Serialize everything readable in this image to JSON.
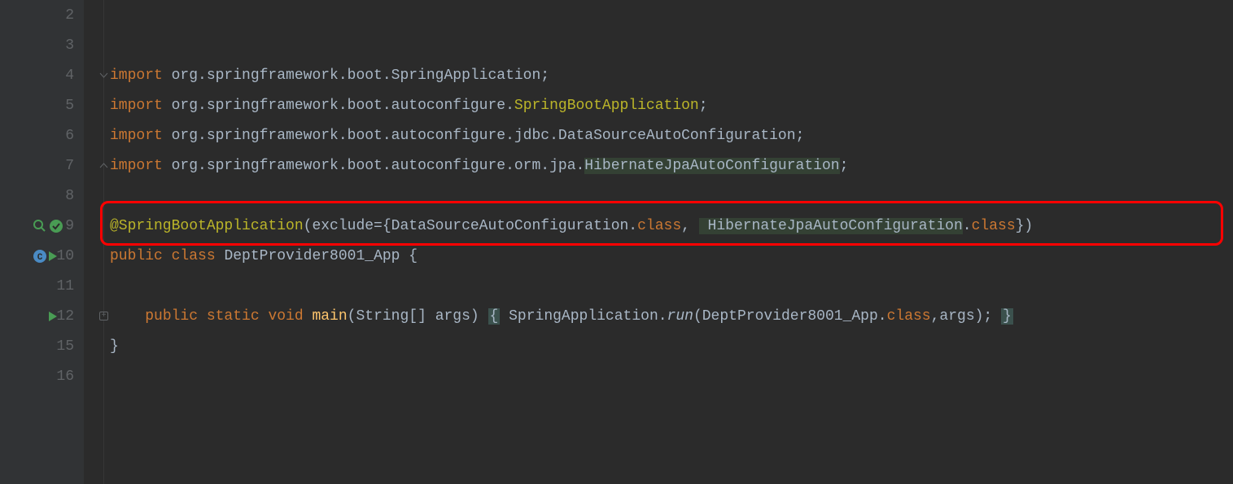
{
  "gutter": {
    "lines": [
      "2",
      "3",
      "4",
      "5",
      "6",
      "7",
      "8",
      "9",
      "10",
      "11",
      "12",
      "15",
      "16"
    ]
  },
  "code": {
    "l4": {
      "kw": "import",
      "rest": " org.springframework.boot.SpringApplication;"
    },
    "l5": {
      "kw": "import",
      "rest1": " org.springframework.boot.autoconfigure.",
      "cls": "SpringBootApplication",
      "rest2": ";"
    },
    "l6": {
      "kw": "import",
      "rest": " org.springframework.boot.autoconfigure.jdbc.DataSourceAutoConfiguration;"
    },
    "l7": {
      "kw": "import",
      "rest1": " org.springframework.boot.autoconfigure.orm.jpa.",
      "cls": "HibernateJpaAutoConfiguration",
      "rest2": ";"
    },
    "l9": {
      "anno": "@SpringBootApplication",
      "p1": "(exclude={DataSourceAutoConfiguration.",
      "kw1": "class",
      "p2": ", ",
      "hl": " HibernateJpaAutoConfiguration",
      "p3": ".",
      "kw2": "class",
      "p4": "})"
    },
    "l10": {
      "kw1": "public class ",
      "cls": "DeptProvider8001_App ",
      "brace": "{"
    },
    "l12": {
      "indent": "    ",
      "kw1": "public static void ",
      "method": "main",
      "p1": "(String[] args) ",
      "brace1": "{",
      "p2": " SpringApplication.",
      "run": "run",
      "p3": "(DeptProvider8001_App.",
      "kw2": "class",
      "p4": ",args); ",
      "brace2": "}"
    },
    "l15": {
      "brace": "}"
    }
  }
}
